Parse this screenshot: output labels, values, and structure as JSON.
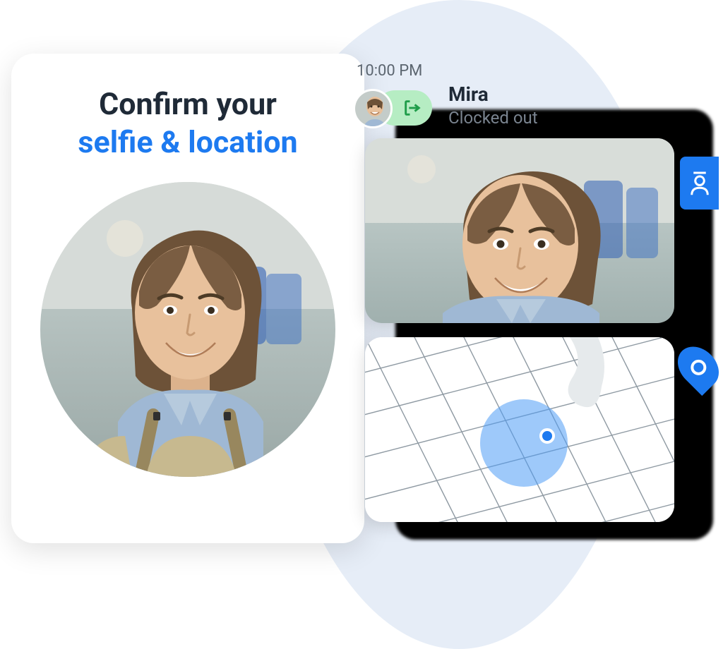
{
  "heading": {
    "line1": "Confirm your",
    "line2": "selfie & location"
  },
  "status": {
    "time": "10:00 PM",
    "name": "Mira",
    "text": "Clocked out",
    "pill_icon": "exit-icon"
  },
  "side_badges": {
    "top": "person-icon",
    "bottom": "location-pin-icon"
  },
  "colors": {
    "accent": "#1d7af0",
    "pill": "#b6edc3",
    "pill_icon": "#1f9d4a"
  }
}
